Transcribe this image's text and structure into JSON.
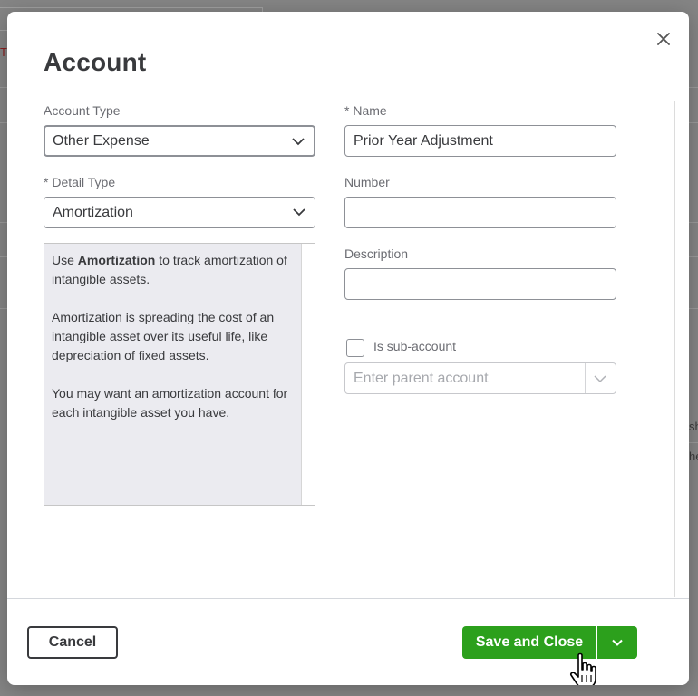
{
  "dialog": {
    "title": "Account",
    "close_icon": "close-icon"
  },
  "form": {
    "account_type": {
      "label": "Account Type",
      "value": "Other Expense"
    },
    "detail_type": {
      "label": "* Detail Type",
      "value": "Amortization"
    },
    "name": {
      "label": "* Name",
      "value": "Prior Year Adjustment"
    },
    "number": {
      "label": "Number",
      "value": ""
    },
    "description": {
      "label": "Description",
      "value": ""
    },
    "sub_account": {
      "label": "Is sub-account",
      "checked": false
    },
    "parent_account": {
      "placeholder": "Enter parent account"
    }
  },
  "help": {
    "p1_prefix": "Use ",
    "p1_bold": "Amortization",
    "p1_suffix": " to track amortization of intangible assets.",
    "p2": "Amortization is spreading the cost of an intangible asset over its useful life, like depreciation of fixed assets.",
    "p3": "You may want an amortization account for each intangible asset you have."
  },
  "footer": {
    "cancel_label": "Cancel",
    "save_label": "Save and Close"
  },
  "background": {
    "fragment_left_1": "T",
    "fragment_right_1": "sh",
    "fragment_right_2": "he"
  },
  "colors": {
    "primary_green": "#2ca01c",
    "text": "#393a3d"
  }
}
